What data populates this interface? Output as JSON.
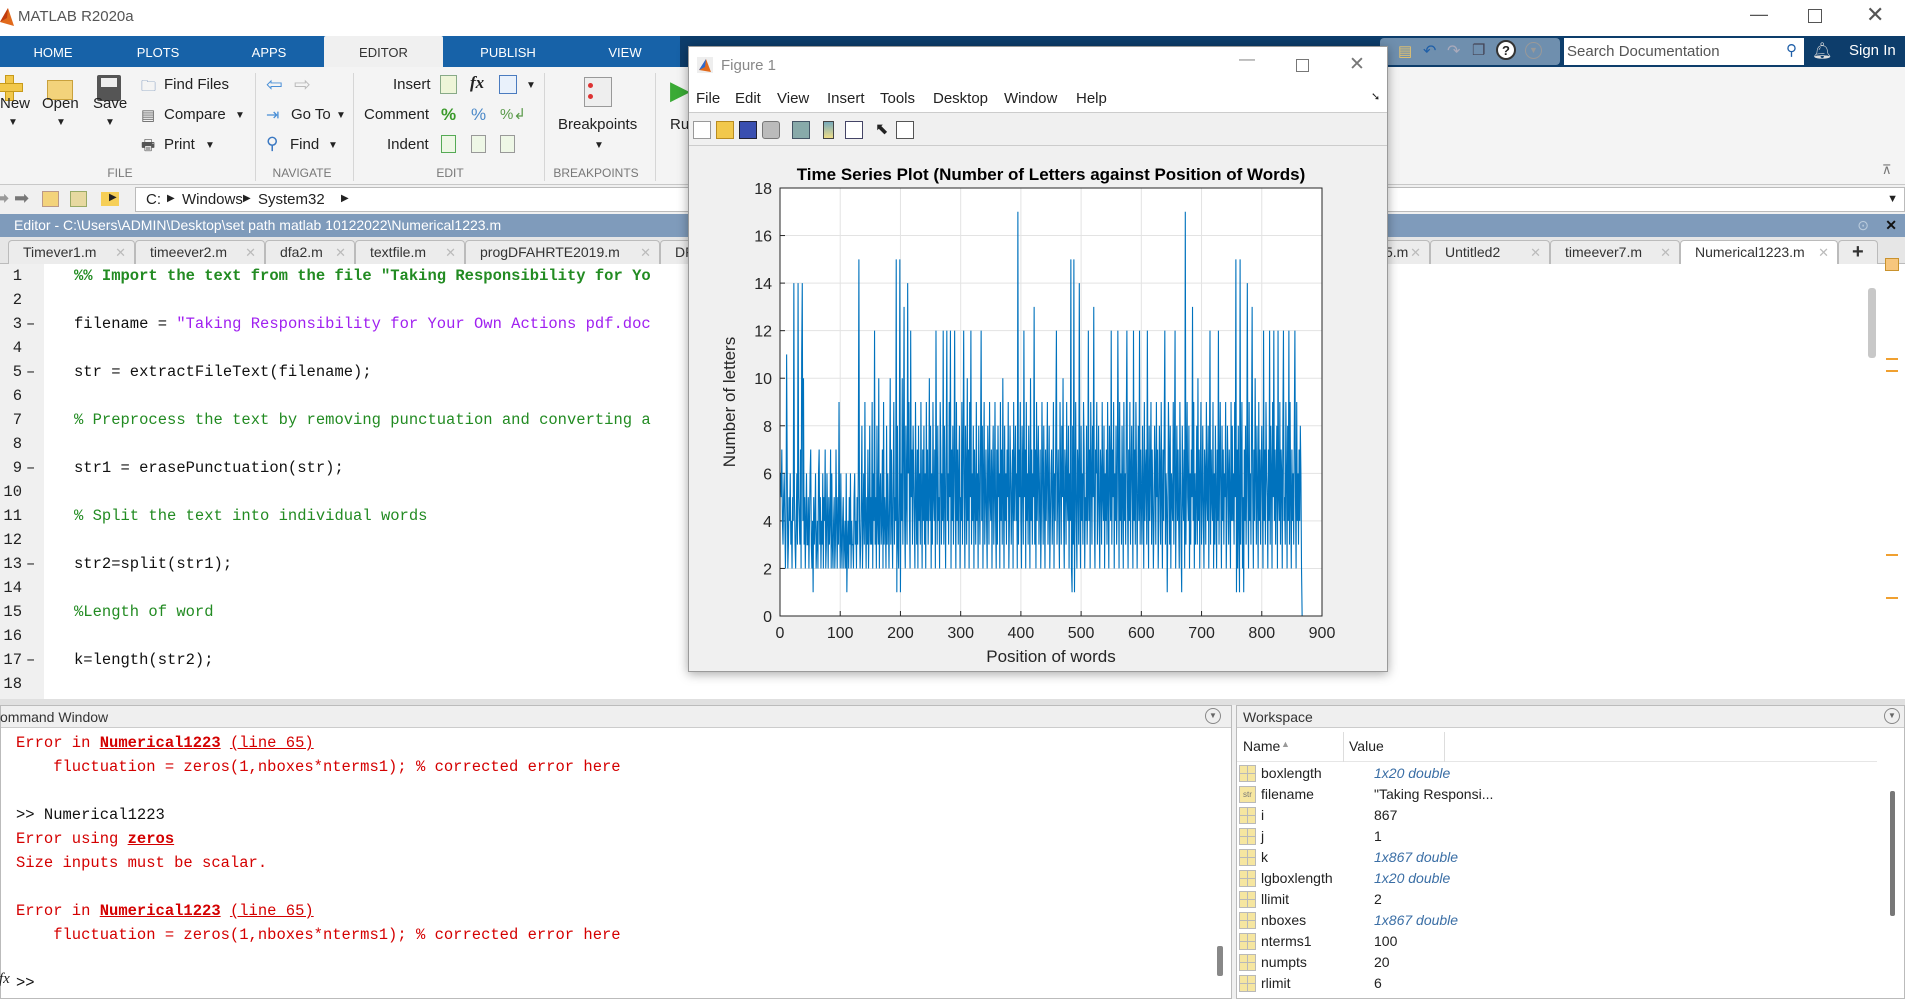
{
  "app": {
    "title": "MATLAB R2020a",
    "window_controls": [
      "minimize",
      "maximize",
      "close"
    ]
  },
  "ribbon": {
    "tabs": [
      {
        "label": "HOME"
      },
      {
        "label": "PLOTS"
      },
      {
        "label": "APPS"
      },
      {
        "label": "EDITOR",
        "active": true
      },
      {
        "label": "PUBLISH"
      },
      {
        "label": "VIEW"
      }
    ],
    "file": {
      "section": "FILE",
      "new": "New",
      "open": "Open",
      "save": "Save",
      "find_files": "Find Files",
      "compare": "Compare",
      "print": "Print"
    },
    "navigate": {
      "section": "NAVIGATE",
      "go_to": "Go To",
      "find": "Find"
    },
    "edit": {
      "section": "EDIT",
      "insert": "Insert",
      "comment": "Comment",
      "indent": "Indent",
      "fx": "fx"
    },
    "breakpoints": {
      "section": "BREAKPOINTS",
      "label": "Breakpoints"
    },
    "run": {
      "label": "Ru"
    },
    "search": {
      "placeholder": "Search Documentation"
    },
    "sign_in": "Sign In"
  },
  "address": {
    "path": [
      "C:",
      "Windows",
      "System32"
    ]
  },
  "editor": {
    "title": "Editor - C:\\Users\\ADMIN\\Desktop\\set path matlab 10122022\\Numerical1223.m",
    "tabs_left": [
      "Timever1.m",
      "timeever2.m",
      "dfa2.m",
      "textfile.m",
      "progDFAHRTE2019.m",
      "DF"
    ],
    "tabs_right": [
      {
        "label": "5.m"
      },
      {
        "label": "Untitled2"
      },
      {
        "label": "timeever7.m"
      },
      {
        "label": "Numerical1223.m",
        "active": true
      }
    ],
    "add_tab": "+",
    "lines": [
      {
        "n": "1",
        "exec": false,
        "segs": [
          {
            "t": "%% Import the text from the file \"Taking Responsibility for Yo",
            "c": "cell"
          }
        ]
      },
      {
        "n": "2",
        "exec": false,
        "segs": []
      },
      {
        "n": "3",
        "exec": true,
        "segs": [
          {
            "t": "filename = ",
            "c": "code"
          },
          {
            "t": "\"Taking Responsibility for Your Own Actions pdf.doc",
            "c": "str"
          }
        ]
      },
      {
        "n": "4",
        "exec": false,
        "segs": []
      },
      {
        "n": "5",
        "exec": true,
        "segs": [
          {
            "t": "str = extractFileText(filename);",
            "c": "code"
          }
        ]
      },
      {
        "n": "6",
        "exec": false,
        "segs": []
      },
      {
        "n": "7",
        "exec": false,
        "segs": [
          {
            "t": "% Preprocess the text by removing punctuation and converting a",
            "c": "com"
          }
        ]
      },
      {
        "n": "8",
        "exec": false,
        "segs": []
      },
      {
        "n": "9",
        "exec": true,
        "segs": [
          {
            "t": "str1 = erasePunctuation(str);",
            "c": "code"
          }
        ]
      },
      {
        "n": "10",
        "exec": false,
        "segs": []
      },
      {
        "n": "11",
        "exec": false,
        "segs": [
          {
            "t": "% Split the text into individual words",
            "c": "com"
          }
        ]
      },
      {
        "n": "12",
        "exec": false,
        "segs": []
      },
      {
        "n": "13",
        "exec": true,
        "segs": [
          {
            "t": "str2=split(str1);",
            "c": "code"
          }
        ]
      },
      {
        "n": "14",
        "exec": false,
        "segs": []
      },
      {
        "n": "15",
        "exec": false,
        "segs": [
          {
            "t": "%Length of word",
            "c": "com"
          }
        ]
      },
      {
        "n": "16",
        "exec": false,
        "segs": []
      },
      {
        "n": "17",
        "exec": true,
        "segs": [
          {
            "t": "k=length(str2);",
            "c": "code"
          }
        ]
      },
      {
        "n": "18",
        "exec": false,
        "segs": []
      }
    ]
  },
  "command_window": {
    "title": "ommand Window",
    "lines": [
      [
        {
          "t": "Error in ",
          "c": "err"
        },
        {
          "t": "Numerical1223",
          "c": "lnk"
        },
        {
          "t": " ",
          "c": "err"
        },
        {
          "t": "(line 65)",
          "c": "ulnk"
        }
      ],
      [
        {
          "t": "    fluctuation = zeros(1,nboxes*nterms1); % corrected error here",
          "c": "err"
        }
      ],
      [],
      [
        {
          "t": ">> Numerical1223",
          "c": "plain"
        }
      ],
      [
        {
          "t": "Error using ",
          "c": "err"
        },
        {
          "t": "zeros",
          "c": "lnk"
        }
      ],
      [
        {
          "t": "Size inputs must be scalar.",
          "c": "err"
        }
      ],
      [],
      [
        {
          "t": "Error in ",
          "c": "err"
        },
        {
          "t": "Numerical1223",
          "c": "lnk"
        },
        {
          "t": " ",
          "c": "err"
        },
        {
          "t": "(line 65)",
          "c": "ulnk"
        }
      ],
      [
        {
          "t": "    fluctuation = zeros(1,nboxes*nterms1); % corrected error here",
          "c": "err"
        }
      ],
      [],
      [
        {
          "t": ">>",
          "c": "plain"
        }
      ]
    ],
    "prompt_icon": "fx"
  },
  "workspace": {
    "title": "Workspace",
    "columns": [
      "Name",
      "Value"
    ],
    "sort_indicator": "▲",
    "rows": [
      {
        "name": "boxlength",
        "value": "1x20 double",
        "array": true,
        "type": "matrix"
      },
      {
        "name": "filename",
        "value": "\"Taking Responsi...",
        "array": false,
        "type": "str"
      },
      {
        "name": "i",
        "value": "867",
        "array": false,
        "type": "matrix"
      },
      {
        "name": "j",
        "value": "1",
        "array": false,
        "type": "matrix"
      },
      {
        "name": "k",
        "value": "1x867 double",
        "array": true,
        "type": "matrix"
      },
      {
        "name": "lgboxlength",
        "value": "1x20 double",
        "array": true,
        "type": "matrix"
      },
      {
        "name": "llimit",
        "value": "2",
        "array": false,
        "type": "matrix"
      },
      {
        "name": "nboxes",
        "value": "1x867 double",
        "array": true,
        "type": "matrix"
      },
      {
        "name": "nterms1",
        "value": "100",
        "array": false,
        "type": "matrix"
      },
      {
        "name": "numpts",
        "value": "20",
        "array": false,
        "type": "matrix"
      },
      {
        "name": "rlimit",
        "value": "6",
        "array": false,
        "type": "matrix"
      }
    ]
  },
  "figure": {
    "title": "Figure 1",
    "menu": [
      "File",
      "Edit",
      "View",
      "Insert",
      "Tools",
      "Desktop",
      "Window",
      "Help"
    ]
  },
  "chart_data": {
    "type": "line",
    "title": "Time Series Plot (Number of Letters against Position of Words)",
    "xlabel": "Position of words",
    "ylabel": "Number of letters",
    "xlim": [
      0,
      900
    ],
    "ylim": [
      0,
      18
    ],
    "xticks": [
      0,
      100,
      200,
      300,
      400,
      500,
      600,
      700,
      800,
      900
    ],
    "yticks": [
      0,
      2,
      4,
      6,
      8,
      10,
      12,
      14,
      16,
      18
    ],
    "grid": true,
    "color": "#0072bd",
    "x_start": 1,
    "values": [
      6,
      5,
      7,
      4,
      3,
      5,
      6,
      4,
      2,
      4,
      11,
      6,
      2,
      3,
      5,
      4,
      6,
      3,
      4,
      2,
      5,
      4,
      14,
      5,
      3,
      2,
      4,
      6,
      3,
      14,
      5,
      4,
      3,
      7,
      2,
      11,
      14,
      4,
      10,
      3,
      5,
      2,
      4,
      6,
      3,
      3,
      5,
      2,
      4,
      6,
      7,
      3,
      2,
      4,
      1,
      5,
      3,
      4,
      6,
      2,
      3,
      4,
      2,
      6,
      7,
      3,
      5,
      2,
      4,
      3,
      6,
      2,
      5,
      4,
      7,
      2,
      3,
      6,
      4,
      2,
      5,
      3,
      4,
      7,
      2,
      6,
      3,
      2,
      4,
      5,
      2,
      3,
      7,
      4,
      2,
      5,
      3,
      9,
      4,
      2,
      6,
      3,
      2,
      4,
      5,
      2,
      3,
      4,
      2,
      6,
      1,
      3,
      4,
      2,
      5,
      3,
      6,
      2,
      4,
      3,
      3,
      2,
      5,
      6,
      3,
      4,
      2,
      5,
      3,
      6,
      15,
      4,
      2,
      3,
      5,
      8,
      2,
      4,
      6,
      3,
      9,
      4,
      2,
      5,
      3,
      7,
      2,
      4,
      8,
      3,
      5,
      3,
      9,
      2,
      6,
      4,
      12,
      3,
      5,
      2,
      8,
      4,
      3,
      10,
      2,
      5,
      6,
      3,
      4,
      7,
      2,
      9,
      3,
      5,
      4,
      2,
      8,
      3,
      6,
      4,
      2,
      5,
      10,
      3,
      7,
      4,
      2,
      6,
      9,
      3,
      5,
      4,
      15,
      1,
      8,
      3,
      2,
      5,
      15,
      1,
      6,
      4,
      10,
      3,
      7,
      13,
      4,
      2,
      8,
      5,
      3,
      14,
      6,
      9,
      4,
      2,
      12,
      5,
      7,
      3,
      8,
      6,
      4,
      2,
      9,
      5,
      3,
      7,
      2,
      8,
      4,
      6,
      3,
      9,
      5,
      2,
      7,
      4,
      8,
      3,
      6,
      2,
      9,
      4,
      7,
      3,
      5,
      10,
      4,
      8,
      2,
      6,
      3,
      9,
      5,
      4,
      7,
      2,
      12,
      6,
      3,
      8,
      4,
      5,
      2,
      9,
      7,
      3,
      6,
      4,
      12,
      3,
      8,
      5,
      2,
      7,
      12,
      4,
      6,
      3,
      9,
      5,
      12,
      2,
      7,
      4,
      8,
      3,
      6,
      12,
      5,
      2,
      9,
      4,
      7,
      3,
      6,
      8,
      2,
      5,
      4,
      9,
      3,
      7,
      12,
      5,
      2,
      8,
      6,
      3,
      10,
      4,
      7,
      2,
      9,
      5,
      12,
      3,
      6,
      4,
      8,
      2,
      7,
      5,
      3,
      9,
      4,
      6,
      2,
      8,
      5,
      3,
      7,
      12,
      4,
      8,
      2,
      6,
      9,
      3,
      5,
      7,
      4,
      2,
      8,
      6,
      3,
      9,
      5,
      4,
      7,
      2,
      6,
      8,
      3,
      5,
      9,
      4,
      2,
      7,
      3,
      8,
      5,
      6,
      2,
      9,
      4,
      7,
      3,
      10,
      5,
      2,
      8,
      4,
      6,
      3,
      7,
      5,
      9,
      2,
      4,
      8,
      6,
      3,
      5,
      7,
      2,
      9,
      4,
      6,
      8,
      4,
      6,
      2,
      17,
      3,
      7,
      5,
      9,
      4,
      2,
      8,
      6,
      3,
      12,
      5,
      7,
      2,
      9,
      4,
      6,
      3,
      8,
      5,
      2,
      10,
      4,
      7,
      3,
      6,
      5,
      13,
      3,
      7,
      2,
      9,
      4,
      6,
      8,
      3,
      5,
      7,
      2,
      4,
      9,
      6,
      3,
      8,
      5,
      2,
      7,
      4,
      6,
      9,
      3,
      5,
      8,
      2,
      4,
      6,
      7,
      3,
      5,
      9,
      2,
      6,
      4,
      8,
      12,
      3,
      5,
      7,
      4,
      2,
      9,
      6,
      3,
      8,
      5,
      10,
      4,
      2,
      7,
      6,
      3,
      9,
      5,
      4,
      8,
      2,
      6,
      4,
      15,
      2,
      1,
      8,
      3,
      15,
      1,
      5,
      9,
      4,
      2,
      7,
      6,
      3,
      14,
      5,
      2,
      8,
      4,
      6,
      3,
      9,
      7,
      2,
      5,
      4,
      8,
      3,
      5,
      12,
      4,
      7,
      2,
      9,
      6,
      3,
      8,
      5,
      13,
      4,
      2,
      7,
      6,
      9,
      3,
      5,
      8,
      4,
      2,
      7,
      6,
      3,
      9,
      5,
      4,
      8,
      2,
      6,
      4,
      7,
      3,
      9,
      5,
      2,
      8,
      6,
      4,
      12,
      3,
      7,
      5,
      9,
      2,
      6,
      4,
      8,
      3,
      5,
      12,
      7,
      2,
      9,
      4,
      6,
      3,
      8,
      5,
      2,
      9,
      4,
      6,
      3,
      8,
      12,
      5,
      2,
      7,
      4,
      9,
      3,
      6,
      8,
      5,
      2,
      12,
      4,
      7,
      3,
      9,
      6,
      2,
      5,
      8,
      4,
      12,
      3,
      7,
      5,
      3,
      8,
      5,
      2,
      9,
      4,
      6,
      7,
      3,
      12,
      5,
      2,
      8,
      4,
      6,
      9,
      3,
      7,
      5,
      2,
      4,
      8,
      6,
      3,
      9,
      5,
      7,
      2,
      4,
      8,
      6,
      3,
      9,
      5,
      2,
      7,
      4,
      8,
      12,
      3,
      6,
      5,
      1,
      4,
      9,
      7,
      3,
      8,
      2,
      6,
      5,
      4,
      9,
      3,
      7,
      12,
      2,
      5,
      8,
      4,
      7,
      4,
      2,
      9,
      6,
      3,
      1,
      8,
      5,
      4,
      7,
      2,
      17,
      3,
      6,
      9,
      5,
      4,
      8,
      2,
      6,
      3,
      7,
      5,
      13,
      4,
      9,
      2,
      6,
      3,
      5,
      8,
      3,
      10,
      4,
      7,
      2,
      6,
      9,
      3,
      5,
      8,
      4,
      2,
      7,
      6,
      3,
      9,
      5,
      4,
      8,
      2,
      6,
      12,
      3,
      7,
      5,
      4,
      9,
      2,
      6,
      3,
      8,
      5,
      2,
      7,
      4,
      12,
      3,
      6,
      9,
      5,
      2,
      8,
      4,
      7,
      3,
      6,
      5,
      9,
      2,
      4,
      8,
      6,
      3,
      7,
      5,
      2,
      9,
      4,
      8,
      4,
      6,
      3,
      9,
      5,
      15,
      1,
      7,
      2,
      8,
      4,
      1,
      15,
      3,
      6,
      9,
      2,
      5,
      1,
      7,
      4,
      8,
      3,
      6,
      14,
      5,
      2,
      9,
      4,
      6,
      3,
      8,
      13,
      5,
      2,
      7,
      4,
      10,
      6,
      3,
      8,
      5,
      2,
      9,
      4,
      7,
      3,
      6,
      8,
      5,
      2,
      12,
      4,
      7,
      3,
      9,
      6,
      5,
      2,
      7,
      4,
      12,
      3,
      8,
      6,
      2,
      9,
      5,
      12,
      4,
      7,
      3,
      6,
      8,
      2,
      12,
      5,
      4,
      9,
      3,
      7,
      6,
      2,
      8,
      12,
      4,
      5,
      3,
      9,
      6,
      2,
      8,
      4,
      12,
      3,
      9,
      5,
      2,
      7,
      4,
      6,
      3,
      8,
      12,
      5,
      2,
      9,
      4,
      6,
      3,
      7,
      4,
      8,
      6,
      2,
      0
    ]
  }
}
